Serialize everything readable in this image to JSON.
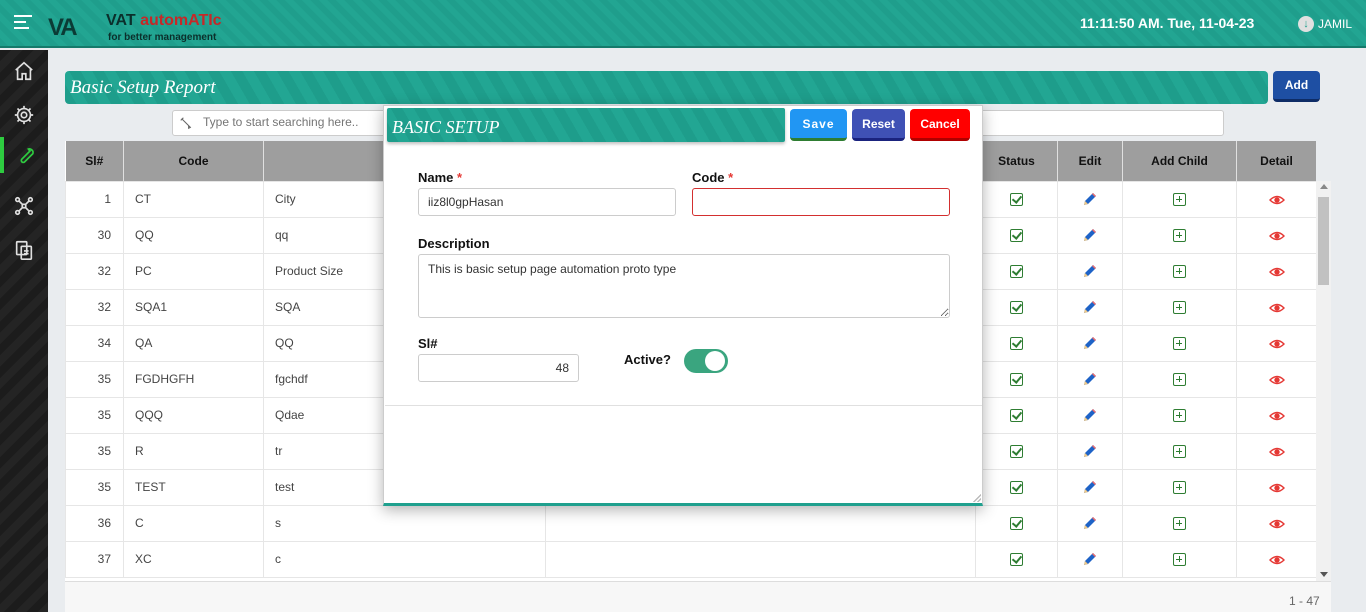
{
  "app": {
    "logo_mark": "VA",
    "logo_title_prefix": "VAT ",
    "logo_title_accent": "automATIc",
    "logo_tagline": "for better management",
    "clock": "11:11:50 AM. Tue, 11-04-23",
    "user": "JAMIL"
  },
  "sidebar": {
    "items": [
      {
        "icon": "home-icon"
      },
      {
        "icon": "gear-icon"
      },
      {
        "icon": "wrench-icon",
        "active": true
      },
      {
        "icon": "network-icon"
      },
      {
        "icon": "documents-icon"
      }
    ]
  },
  "report": {
    "title": "Basic Setup Report",
    "add_label": "Add",
    "search_placeholder": "Type to start searching here..",
    "pager": "1 - 47"
  },
  "table": {
    "headers": [
      "Sl#",
      "Code",
      "",
      "",
      "Status",
      "Edit",
      "Add Child",
      "Detail"
    ],
    "rows": [
      {
        "sl": "1",
        "code": "CT",
        "name": "City"
      },
      {
        "sl": "30",
        "code": "QQ",
        "name": "qq"
      },
      {
        "sl": "32",
        "code": "PC",
        "name": "Product Size"
      },
      {
        "sl": "32",
        "code": "SQA1",
        "name": "SQA"
      },
      {
        "sl": "34",
        "code": "QA",
        "name": "QQ"
      },
      {
        "sl": "35",
        "code": "FGDHGFH",
        "name": "fgchdf"
      },
      {
        "sl": "35",
        "code": "QQQ",
        "name": "Qdae"
      },
      {
        "sl": "35",
        "code": "R",
        "name": "tr"
      },
      {
        "sl": "35",
        "code": "TEST",
        "name": "test"
      },
      {
        "sl": "36",
        "code": "C",
        "name": "s"
      },
      {
        "sl": "37",
        "code": "XC",
        "name": "c"
      }
    ]
  },
  "modal": {
    "title": "BASIC SETUP",
    "save_label": "Save",
    "reset_label": "Reset",
    "cancel_label": "Cancel",
    "name_label": "Name",
    "name_value": "iiz8l0gpHasan",
    "code_label": "Code",
    "code_value": "",
    "required_mark": "*",
    "description_label": "Description",
    "description_value": "This is basic setup page automation proto type",
    "sl_label": "Sl#",
    "sl_value": "48",
    "active_label": "Active?",
    "active_value": true
  },
  "colors": {
    "brand_teal": "#1f9e8c",
    "save_blue": "#2196f3",
    "reset_indigo": "#3f51b5",
    "cancel_red": "#ff0000",
    "toggle_green": "#3aa57f"
  }
}
